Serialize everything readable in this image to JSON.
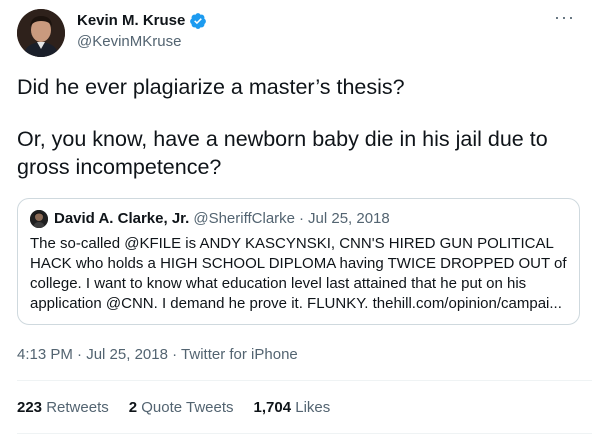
{
  "author": {
    "name": "Kevin M. Kruse",
    "handle": "@KevinMKruse",
    "verified": true,
    "verified_color": "#1d9bf0"
  },
  "more_label": "···",
  "tweet": {
    "paragraph1": "Did he ever plagiarize a master’s thesis?",
    "paragraph2": "Or, you know, have a newborn baby die in his jail due to gross incompetence?"
  },
  "quoted_tweet": {
    "name": "David A. Clarke, Jr.",
    "handle": "@SheriffClarke",
    "separator": "·",
    "date": "Jul 25, 2018",
    "lines": [
      "The so-called @KFILE is ANDY KASCYNSKI, CNN'S HIRED GUN POLITICAL",
      "HACK who holds a HIGH SCHOOL DIPLOMA having TWICE DROPPED OUT of",
      "college. I want to know what education level last attained that he put on his",
      "application @CNN. I demand he prove it. FLUNKY. thehill.com/opinion/campai..."
    ]
  },
  "meta": {
    "time": "4:13 PM",
    "date": "Jul 25, 2018",
    "source": "Twitter for iPhone",
    "separator": "·"
  },
  "stats": {
    "retweets_count": "223",
    "retweets_label": "Retweets",
    "quotes_count": "2",
    "quotes_label": "Quote Tweets",
    "likes_count": "1,704",
    "likes_label": "Likes"
  }
}
